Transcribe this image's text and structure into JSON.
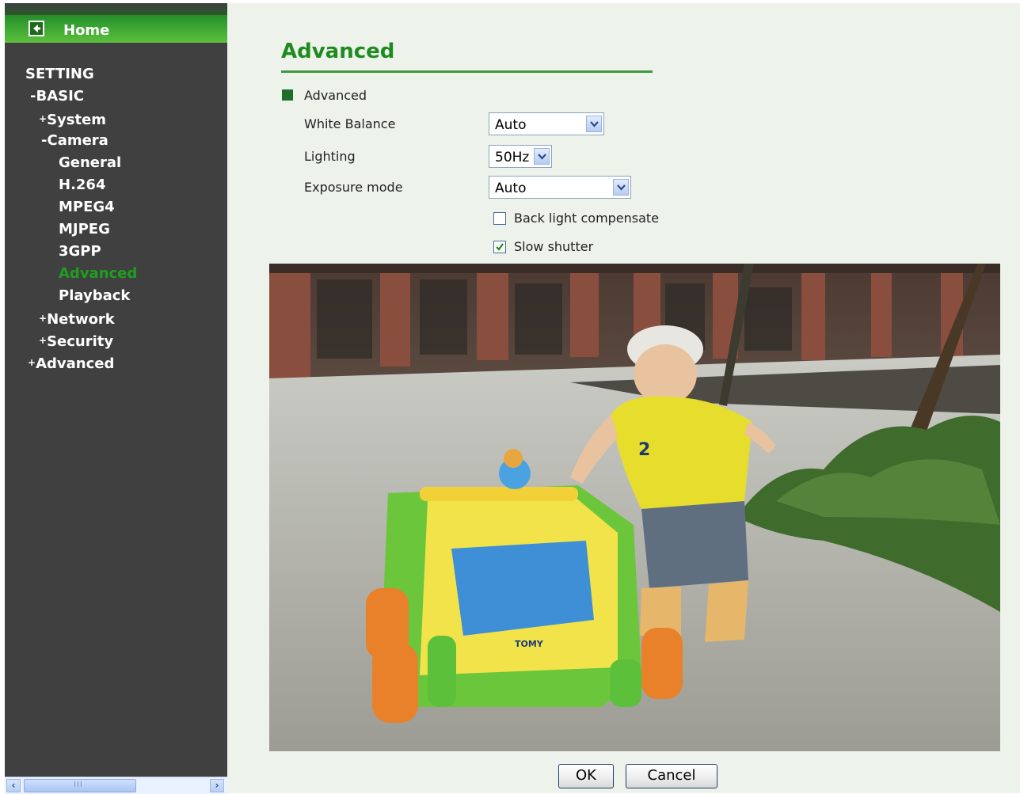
{
  "sidebar": {
    "home_label": "Home",
    "items": [
      {
        "prefix": "",
        "label": "SETTING"
      },
      {
        "prefix": "-",
        "label": "BASIC"
      },
      {
        "prefix": "+",
        "label": "System"
      },
      {
        "prefix": "-",
        "label": "Camera"
      },
      {
        "prefix": "",
        "label": "General"
      },
      {
        "prefix": "",
        "label": "H.264"
      },
      {
        "prefix": "",
        "label": "MPEG4"
      },
      {
        "prefix": "",
        "label": "MJPEG"
      },
      {
        "prefix": "",
        "label": "3GPP"
      },
      {
        "prefix": "",
        "label": "Advanced",
        "active": true
      },
      {
        "prefix": "",
        "label": "Playback"
      },
      {
        "prefix": "+",
        "label": "Network"
      },
      {
        "prefix": "+",
        "label": "Security"
      },
      {
        "prefix": "+",
        "label": "Advanced"
      }
    ],
    "scroll_thumb_grip": "III"
  },
  "main": {
    "title": "Advanced",
    "section_label": "Advanced",
    "fields": {
      "white_balance": {
        "label": "White Balance",
        "value": "Auto"
      },
      "lighting": {
        "label": "Lighting",
        "value": "50Hz"
      },
      "exposure_mode": {
        "label": "Exposure mode",
        "value": "Auto"
      }
    },
    "checkboxes": {
      "back_light": {
        "label": "Back light compensate",
        "checked": false
      },
      "slow_shutter": {
        "label": "Slow shutter",
        "checked": true
      }
    },
    "buttons": {
      "ok": "OK",
      "cancel": "Cancel"
    },
    "preview": {
      "toy_brand": "TOMY",
      "shirt_number": "2"
    }
  },
  "colors": {
    "sidebar_bg": "#404040",
    "accent_green": "#1f8a1f",
    "active_nav": "#1e9e1e",
    "main_bg": "#edf2eb"
  }
}
